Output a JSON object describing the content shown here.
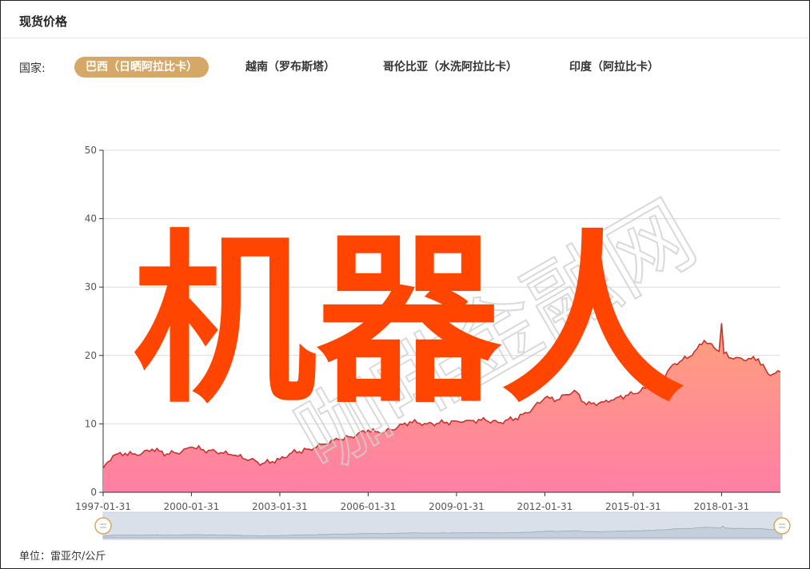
{
  "header": {
    "title": "现货价格"
  },
  "filters": {
    "label": "国家:",
    "tabs": [
      {
        "label": "巴西（日晒阿拉比卡）",
        "active": true
      },
      {
        "label": "越南（罗布斯塔）",
        "active": false
      },
      {
        "label": "哥伦比亚（水洗阿拉比卡）",
        "active": false
      },
      {
        "label": "印度（阿拉比卡）",
        "active": false
      }
    ]
  },
  "footer": {
    "unit": "单位：雷亚尔/公斤"
  },
  "overlay": {
    "text": "机器人",
    "color": "#ff4500"
  },
  "watermark": {
    "text": "咖啡金融网"
  },
  "colors": {
    "line": "#c23531",
    "fill_top": "#ffa07a",
    "fill_bottom": "#ff7fa6",
    "tab_active": "#d5a867",
    "slider_bg": "#d9e0ea"
  },
  "chart_data": {
    "type": "area",
    "xlim": [
      "1997-01-31",
      "2020-01-31"
    ],
    "ylim": [
      0,
      50
    ],
    "yticks": [
      0,
      10,
      20,
      30,
      40,
      50
    ],
    "xticks": [
      "1997-01-31",
      "2000-01-31",
      "2003-01-31",
      "2006-01-31",
      "2009-01-31",
      "2012-01-31",
      "2015-01-31",
      "2018-01-31"
    ],
    "grid": true,
    "points": [
      [
        "1997-01-31",
        3.5
      ],
      [
        "1997-05-31",
        5.3
      ],
      [
        "1997-10-31",
        5.7
      ],
      [
        "1998-03-31",
        5.4
      ],
      [
        "1998-09-30",
        6.3
      ],
      [
        "1999-03-31",
        5.6
      ],
      [
        "1999-09-30",
        5.9
      ],
      [
        "2000-01-31",
        6.6
      ],
      [
        "2000-06-30",
        6.2
      ],
      [
        "2001-01-31",
        5.8
      ],
      [
        "2001-06-30",
        5.4
      ],
      [
        "2002-01-31",
        4.8
      ],
      [
        "2002-06-30",
        4.2
      ],
      [
        "2003-01-31",
        4.8
      ],
      [
        "2003-06-30",
        5.8
      ],
      [
        "2004-01-31",
        6.3
      ],
      [
        "2004-06-30",
        7.0
      ],
      [
        "2005-01-31",
        7.7
      ],
      [
        "2005-06-30",
        8.1
      ],
      [
        "2006-01-31",
        9.1
      ],
      [
        "2006-06-30",
        8.6
      ],
      [
        "2007-01-31",
        9.5
      ],
      [
        "2007-06-30",
        10.3
      ],
      [
        "2008-01-31",
        10.0
      ],
      [
        "2008-06-30",
        10.1
      ],
      [
        "2009-01-31",
        10.4
      ],
      [
        "2009-06-30",
        10.5
      ],
      [
        "2010-01-31",
        10.5
      ],
      [
        "2010-06-30",
        10.2
      ],
      [
        "2011-01-31",
        10.8
      ],
      [
        "2011-06-30",
        11.6
      ],
      [
        "2012-01-31",
        13.8
      ],
      [
        "2012-06-30",
        13.5
      ],
      [
        "2013-01-31",
        14.9
      ],
      [
        "2013-06-30",
        12.8
      ],
      [
        "2014-01-31",
        13.2
      ],
      [
        "2014-06-30",
        13.8
      ],
      [
        "2015-01-31",
        14.4
      ],
      [
        "2015-06-30",
        15.2
      ],
      [
        "2016-01-31",
        16.8
      ],
      [
        "2016-06-30",
        18.8
      ],
      [
        "2017-01-31",
        20.0
      ],
      [
        "2017-06-30",
        22.2
      ],
      [
        "2017-12-31",
        20.6
      ],
      [
        "2018-01-31",
        24.7
      ],
      [
        "2018-02-28",
        20.3
      ],
      [
        "2018-06-30",
        19.5
      ],
      [
        "2019-01-31",
        19.5
      ],
      [
        "2019-04-30",
        19.5
      ],
      [
        "2019-08-31",
        17.3
      ],
      [
        "2020-01-31",
        17.6
      ]
    ]
  }
}
